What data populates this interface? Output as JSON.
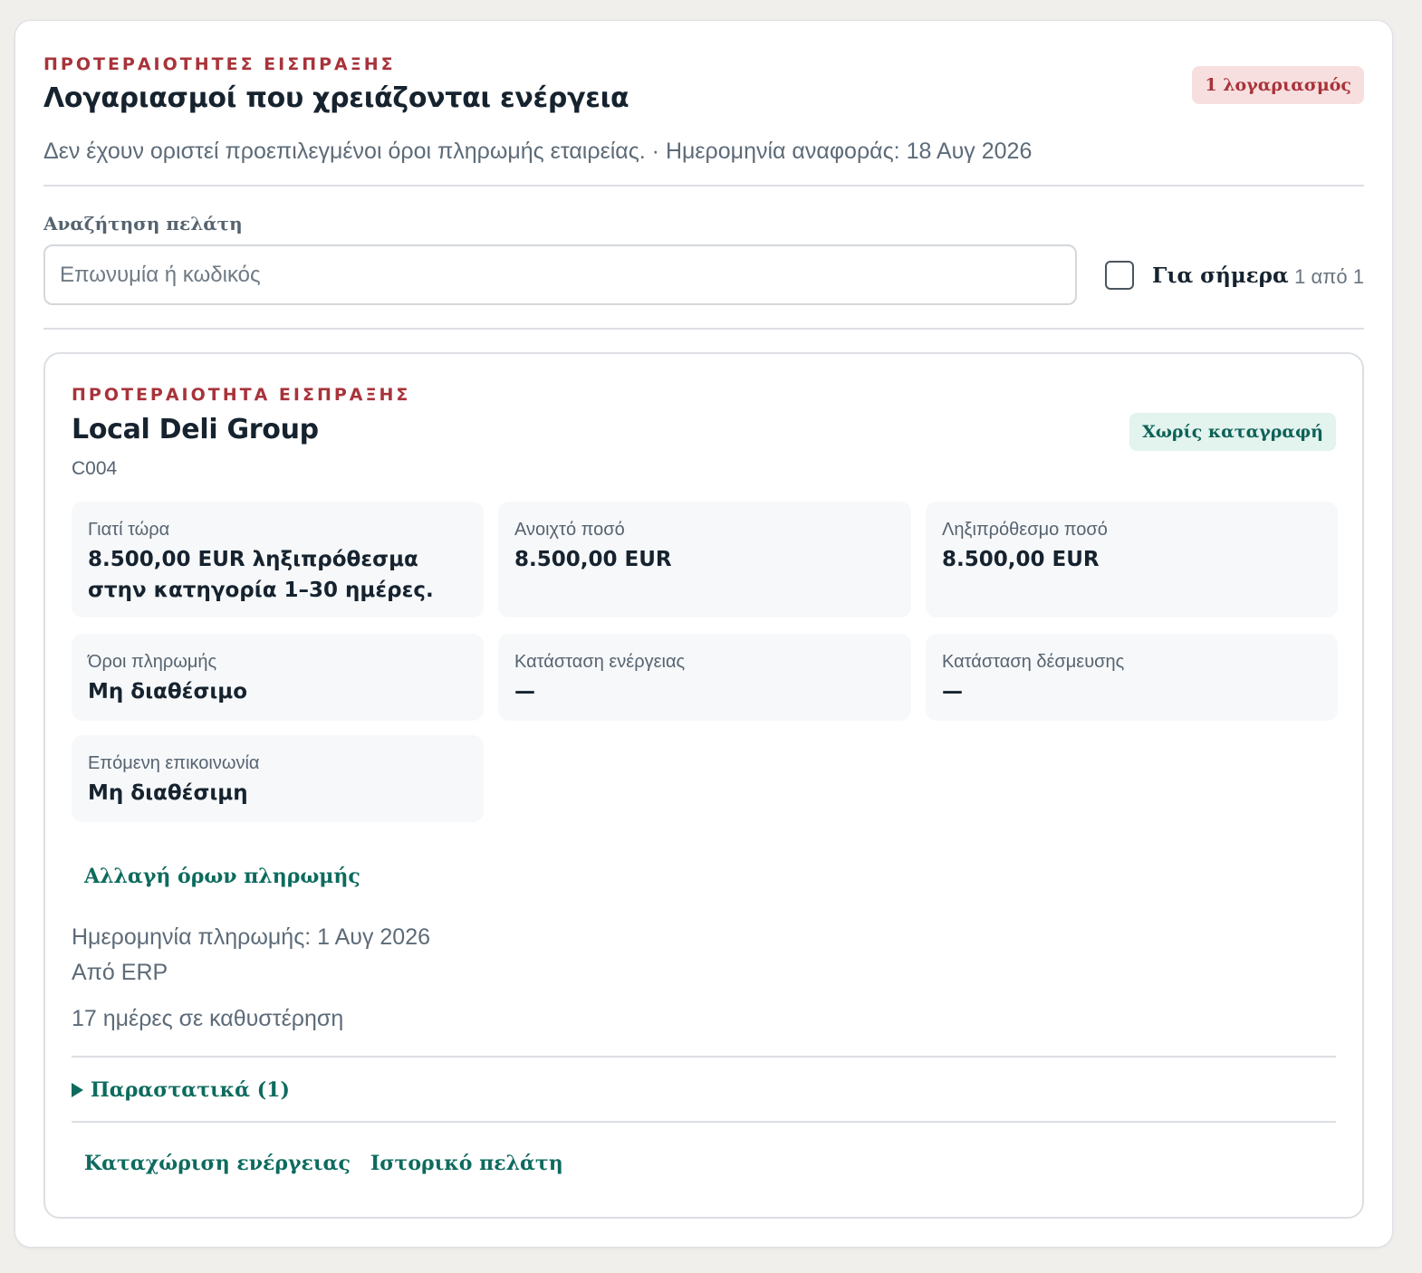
{
  "header": {
    "eyebrow": "ΠΡΟΤΕΡΑΙΟΤΗΤΕΣ ΕΙΣΠΡΑΞΗΣ",
    "title": "Λογαριασμοί που χρειάζονται ενέργεια",
    "count_badge": "1 λογαριασμός",
    "subtitle": "Δεν έχουν οριστεί προεπιλεγμένοι όροι πληρωμής εταιρείας. · Ημερομηνία αναφοράς: 18 Αυγ 2026"
  },
  "search": {
    "label": "Αναζήτηση πελάτη",
    "placeholder": "Επωνυμία ή κωδικός",
    "value": "",
    "today_label": "Για σήμερα",
    "today_checked": false,
    "result_count": "1 από 1"
  },
  "account": {
    "eyebrow": "ΠΡΟΤΕΡΑΙΟΤΗΤΑ ΕΙΣΠΡΑΞΗΣ",
    "name": "Local Deli Group",
    "code": "C004",
    "status_badge": "Χωρίς καταγραφή",
    "tiles": {
      "why_now": {
        "label": "Γιατί τώρα",
        "value": "8.500,00 EUR ληξιπρόθεσμα στην κατηγορία 1–30 ημέρες."
      },
      "open_amount": {
        "label": "Ανοιχτό ποσό",
        "value": "8.500,00 EUR"
      },
      "overdue_amount": {
        "label": "Ληξιπρόθεσμο ποσό",
        "value": "8.500,00 EUR"
      },
      "payment_terms": {
        "label": "Όροι πληρωμής",
        "value": "Μη διαθέσιμο"
      },
      "action_status": {
        "label": "Κατάσταση ενέργειας",
        "value": "—"
      },
      "commitment_status": {
        "label": "Κατάσταση δέσμευσης",
        "value": "—"
      },
      "next_contact": {
        "label": "Επόμενη επικοινωνία",
        "value": "Μη διαθέσιμη"
      }
    },
    "change_terms_label": "Αλλαγή όρων πληρωμής",
    "payment_date": "Ημερομηνία πληρωμής: 1 Αυγ 2026",
    "source": "Από ERP",
    "days_overdue": "17 ημέρες σε καθυστέρηση",
    "documents_label": "Παραστατικά (1)",
    "record_action_label": "Καταχώριση ενέργειας",
    "customer_history_label": "Ιστορικό πελάτη"
  },
  "colors": {
    "accent_red": "#a8333a",
    "accent_teal": "#0d6b5e",
    "badge_red_bg": "#f8dfdf",
    "badge_teal_bg": "#e3f3ee"
  },
  "icons": {
    "documents_toggle": "triangle-right-icon",
    "today_checkbox": "checkbox-icon"
  }
}
